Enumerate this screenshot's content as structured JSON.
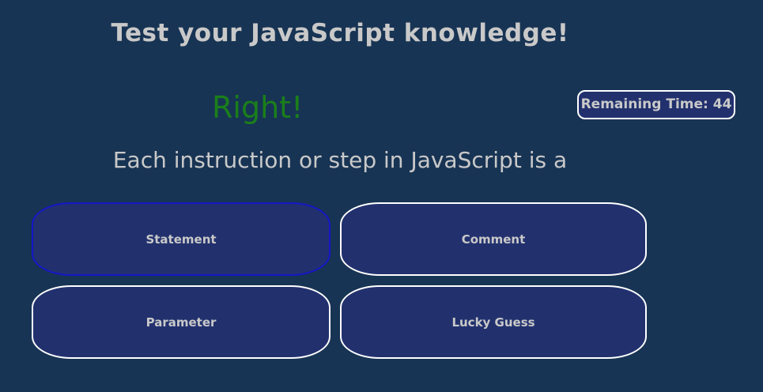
{
  "title": "Test your JavaScript knowledge!",
  "result": "Right!",
  "timer": {
    "label": "Remaining Time:",
    "value": "44"
  },
  "question": "Each instruction or step in JavaScript is a",
  "answers": [
    "Statement",
    "Comment",
    "Parameter",
    "Lucky Guess"
  ],
  "selected_answer": "Statement",
  "colors": {
    "background": "#183454",
    "button_fill": "#22316e",
    "selected_border": "#1616c8",
    "correct_text": "#1a7f1a",
    "text": "#c9c9c9"
  }
}
